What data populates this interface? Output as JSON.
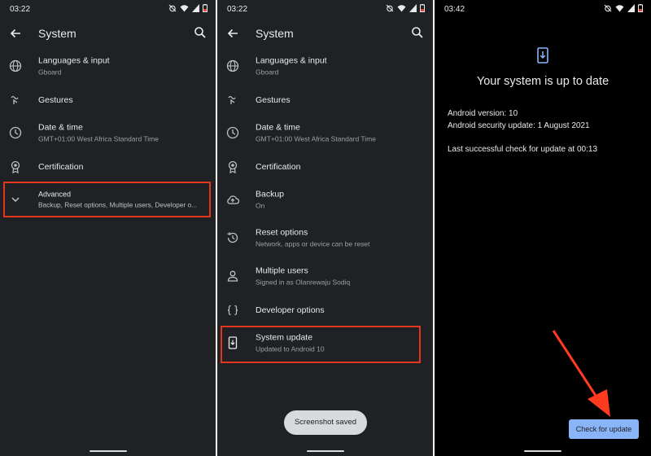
{
  "colors": {
    "background": "#202124",
    "highlight": "#e2371d",
    "accent_button": "#8ab4f8",
    "arrow": "#ff3b1f"
  },
  "panel1": {
    "status_time": "03:22",
    "title": "System",
    "items": [
      {
        "label": "Languages & input",
        "sub": "Gboard",
        "icon": "globe-icon"
      },
      {
        "label": "Gestures",
        "sub": "",
        "icon": "gestures-icon"
      },
      {
        "label": "Date & time",
        "sub": "GMT+01:00 West Africa Standard Time",
        "icon": "clock-icon"
      },
      {
        "label": "Certification",
        "sub": "",
        "icon": "certification-icon"
      },
      {
        "label": "Advanced",
        "sub": "Backup, Reset options, Multiple users, Developer o...",
        "icon": "chevron-down-icon"
      }
    ]
  },
  "panel2": {
    "status_time": "03:22",
    "title": "System",
    "items": [
      {
        "label": "Languages & input",
        "sub": "Gboard",
        "icon": "globe-icon"
      },
      {
        "label": "Gestures",
        "sub": "",
        "icon": "gestures-icon"
      },
      {
        "label": "Date & time",
        "sub": "GMT+01:00 West Africa Standard Time",
        "icon": "clock-icon"
      },
      {
        "label": "Certification",
        "sub": "",
        "icon": "certification-icon"
      },
      {
        "label": "Backup",
        "sub": "On",
        "icon": "cloud-upload-icon"
      },
      {
        "label": "Reset options",
        "sub": "Network, apps or device can be reset",
        "icon": "history-icon"
      },
      {
        "label": "Multiple users",
        "sub": "Signed in as Olanrewaju Sodiq",
        "icon": "person-icon"
      },
      {
        "label": "Developer options",
        "sub": "",
        "icon": "braces-icon"
      },
      {
        "label": "System update",
        "sub": "Updated to Android 10",
        "icon": "system-update-icon"
      }
    ],
    "toast": "Screenshot saved"
  },
  "panel3": {
    "status_time": "03:42",
    "title": "Your system is up to date",
    "android_version": "Android version: 10",
    "security_update": "Android security update: 1 August 2021",
    "last_check": "Last successful check for update at 00:13",
    "button": "Check for update"
  }
}
